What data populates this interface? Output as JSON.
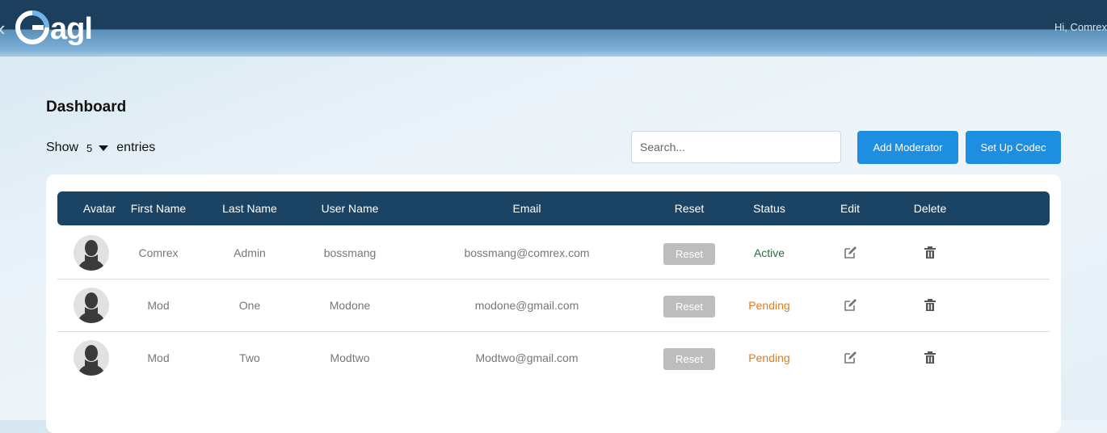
{
  "header": {
    "logo_text": "agl",
    "left_glyph": "‹",
    "greeting": "Hi, Comrex"
  },
  "page": {
    "title": "Dashboard"
  },
  "entries": {
    "show_label": "Show",
    "count": "5",
    "entries_label": "entries"
  },
  "search": {
    "placeholder": "Search...",
    "value": ""
  },
  "actions": {
    "add_moderator": "Add Moderator",
    "setup_codec": "Set Up Codec"
  },
  "table": {
    "columns": [
      "Avatar",
      "First Name",
      "Last Name",
      "User Name",
      "Email",
      "Reset",
      "Status",
      "Edit",
      "Delete"
    ],
    "rows": [
      {
        "first": "Comrex",
        "last": "Admin",
        "user": "bossmang",
        "email": "bossmang@comrex.com",
        "reset": "Reset",
        "status": "Active",
        "status_type": "active"
      },
      {
        "first": "Mod",
        "last": "One",
        "user": "Modone",
        "email": "modone@gmail.com",
        "reset": "Reset",
        "status": "Pending",
        "status_type": "pending"
      },
      {
        "first": "Mod",
        "last": "Two",
        "user": "Modtwo",
        "email": "Modtwo@gmail.com",
        "reset": "Reset",
        "status": "Pending",
        "status_type": "pending"
      }
    ]
  },
  "icons": {
    "avatar": "user-silhouette-icon",
    "edit": "edit-icon",
    "delete": "trash-icon"
  },
  "colors": {
    "navbar": "#1c3f5e",
    "table_header": "#1b4363",
    "primary_button": "#1e8ee0",
    "reset_button": "#bdbdbd",
    "status_active": "#2f6b3a",
    "status_pending": "#e07b1e"
  }
}
